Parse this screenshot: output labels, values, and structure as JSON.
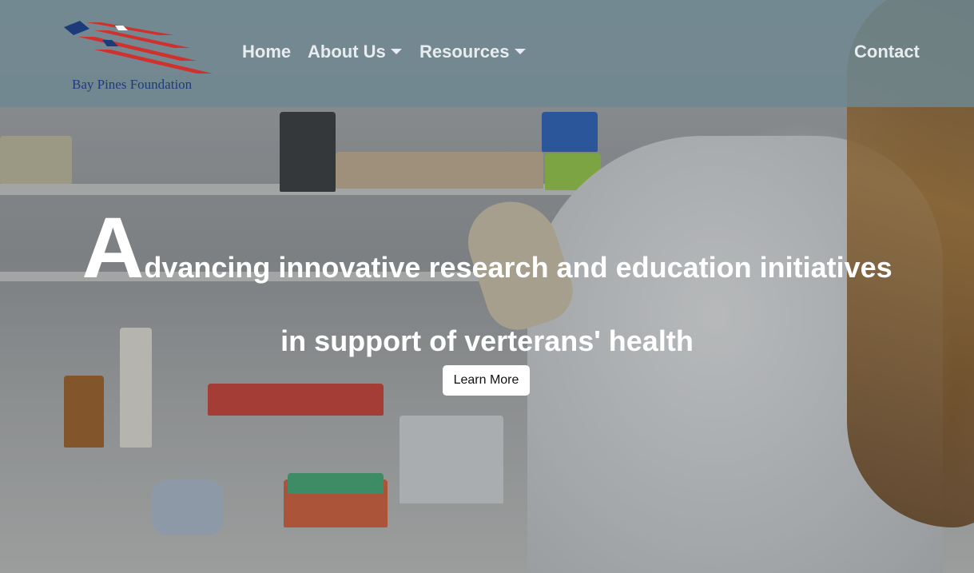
{
  "brand": {
    "name": "Bay Pines Foundation",
    "logo_icon": "flag-stripes-logo",
    "colors": {
      "stripe_red": "#d0312d",
      "stripe_blue": "#1d3b7a"
    }
  },
  "nav": {
    "home": "Home",
    "about": "About Us",
    "resources": "Resources",
    "contact": "Contact"
  },
  "hero": {
    "initial": "A",
    "line1_rest": "dvancing innovative research and education initiatives",
    "line2": "in support of verterans' health",
    "cta_label": "Learn More",
    "background_icon": "lab-photo-background"
  }
}
